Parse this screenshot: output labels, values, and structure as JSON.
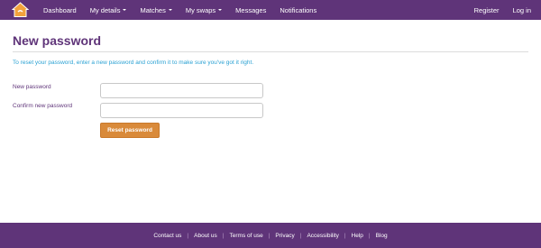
{
  "nav": {
    "logo_icon": "home-icon",
    "items": [
      {
        "label": "Dashboard",
        "dropdown": false
      },
      {
        "label": "My details",
        "dropdown": true
      },
      {
        "label": "Matches",
        "dropdown": true
      },
      {
        "label": "My swaps",
        "dropdown": true
      },
      {
        "label": "Messages",
        "dropdown": false
      },
      {
        "label": "Notifications",
        "dropdown": false
      }
    ],
    "right_items": [
      {
        "label": "Register"
      },
      {
        "label": "Log in"
      }
    ]
  },
  "main": {
    "title": "New password",
    "intro": "To reset your password, enter a new password and confirm it to make sure you've got it right.",
    "fields": {
      "new_password": {
        "label": "New password",
        "value": "",
        "placeholder": ""
      },
      "confirm_password": {
        "label": "Confirm new password",
        "value": "",
        "placeholder": ""
      }
    },
    "submit_label": "Reset password"
  },
  "footer": {
    "links": [
      "Contact us",
      "About us",
      "Terms of use",
      "Privacy",
      "Accessibility",
      "Help",
      "Blog"
    ],
    "separator": "|"
  },
  "colors": {
    "brand_purple": "#5f3479",
    "accent_orange": "#d98a3a",
    "info_blue": "#2aa1d3"
  }
}
